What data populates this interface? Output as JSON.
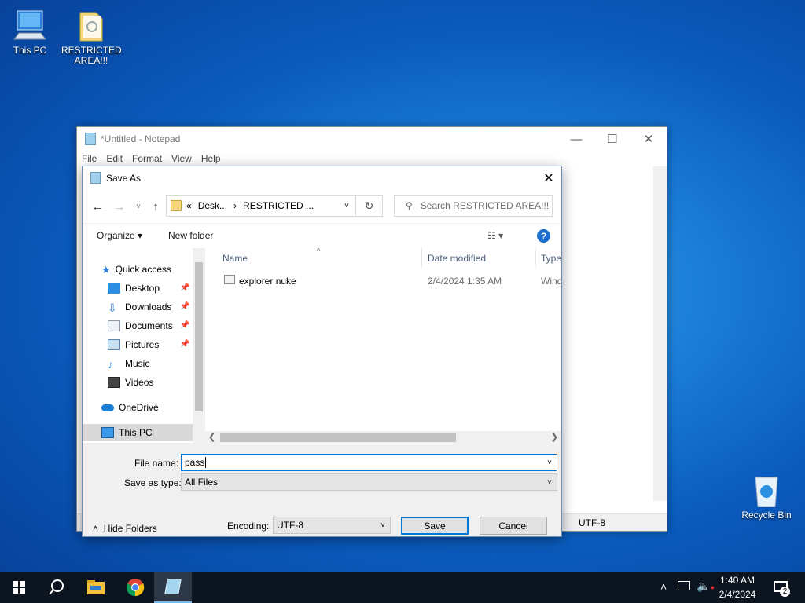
{
  "desktop": {
    "icons": [
      {
        "label": "This PC",
        "icon": "computer-icon"
      },
      {
        "label": "RESTRICTED AREA!!!",
        "icon": "folder-icon"
      }
    ],
    "recycle_bin": "Recycle Bin"
  },
  "notepad": {
    "title": "*Untitled - Notepad",
    "menu": [
      "File",
      "Edit",
      "Format",
      "View",
      "Help"
    ],
    "encoding_status": "UTF-8"
  },
  "dialog": {
    "title": "Save As",
    "address": {
      "prefix": "«",
      "crumb1": "Desk...",
      "sep": "›",
      "crumb2": "RESTRICTED ..."
    },
    "search_placeholder": "Search RESTRICTED AREA!!!",
    "organize": "Organize",
    "new_folder": "New folder",
    "nav": {
      "quick_access": "Quick access",
      "items": [
        "Desktop",
        "Downloads",
        "Documents",
        "Pictures",
        "Music",
        "Videos"
      ],
      "onedrive": "OneDrive",
      "this_pc": "This PC"
    },
    "columns": {
      "name": "Name",
      "date": "Date modified",
      "type": "Type"
    },
    "files": [
      {
        "name": "explorer nuke",
        "date": "2/4/2024 1:35 AM",
        "type": "Wind"
      }
    ],
    "file_name_label": "File name:",
    "file_name_value": "pass",
    "save_type_label": "Save as type:",
    "save_type_value": "All Files",
    "hide_folders": "Hide Folders",
    "encoding_label": "Encoding:",
    "encoding_value": "UTF-8",
    "save": "Save",
    "cancel": "Cancel"
  },
  "taskbar": {
    "time": "1:40 AM",
    "date": "2/4/2024",
    "notifications": "2"
  }
}
